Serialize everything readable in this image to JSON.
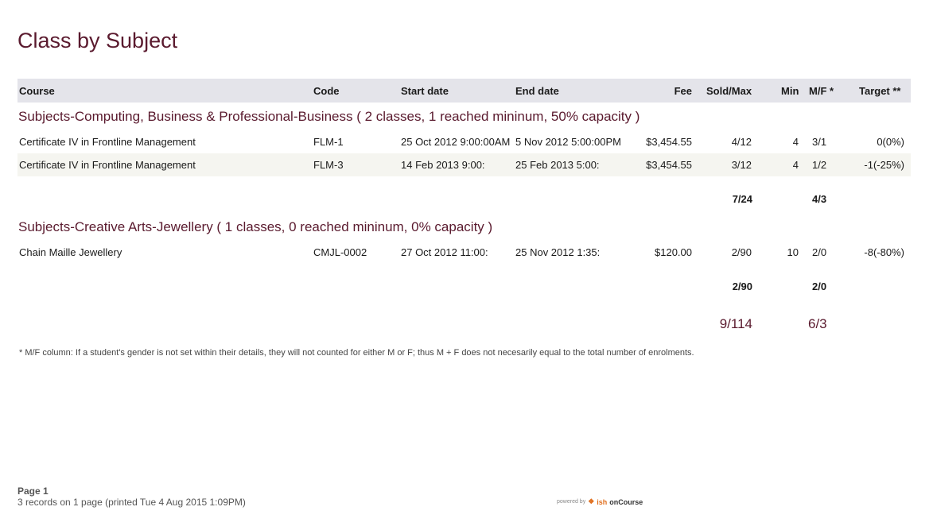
{
  "report": {
    "title": "Class by Subject",
    "headers": {
      "course": "Course",
      "code": "Code",
      "start": "Start date",
      "end": "End date",
      "fee": "Fee",
      "sold": "Sold/Max",
      "min": "Min",
      "mf": "M/F *",
      "target": "Target **"
    },
    "groups": [
      {
        "title": "Subjects-Computing, Business & Professional-Business ( 2 classes, 1 reached mininum, 50% capacity )",
        "rows": [
          {
            "course": "Certificate IV in Frontline Management",
            "code": "FLM-1",
            "start": "25 Oct 2012 9:00:00AM",
            "end": "5 Nov 2012 5:00:00PM",
            "fee": "$3,454.55",
            "sold": "4/12",
            "min": "4",
            "mf": "3/1",
            "target": "0(0%)"
          },
          {
            "course": "Certificate IV in Frontline Management",
            "code": "FLM-3",
            "start": "14 Feb 2013 9:00:",
            "end": "25 Feb 2013 5:00:",
            "fee": "$3,454.55",
            "sold": "3/12",
            "min": "4",
            "mf": "1/2",
            "target": "-1(-25%)"
          }
        ],
        "subtotal": {
          "sold": "7/24",
          "mf": "4/3"
        }
      },
      {
        "title": "Subjects-Creative Arts-Jewellery ( 1 classes, 0 reached mininum, 0% capacity )",
        "rows": [
          {
            "course": "Chain Maille Jewellery",
            "code": "CMJL-0002",
            "start": "27 Oct 2012 11:00:",
            "end": "25 Nov 2012 1:35:",
            "fee": "$120.00",
            "sold": "2/90",
            "min": "10",
            "mf": "2/0",
            "target": "-8(-80%)"
          }
        ],
        "subtotal": {
          "sold": "2/90",
          "mf": "2/0"
        }
      }
    ],
    "grand_total": {
      "sold": "9/114",
      "mf": "6/3"
    },
    "note": "* M/F column: If a student's gender is not set within their details, they will not counted for either M or F; thus M + F does not necesarily equal to the total number of enrolments.",
    "footer": {
      "page": "Page 1",
      "records": "3 records on 1 page (printed Tue 4 Aug 2015 1:09PM)",
      "powered_by": "powered by",
      "logo_mark": "ish",
      "logo_brand": "onCourse"
    }
  }
}
